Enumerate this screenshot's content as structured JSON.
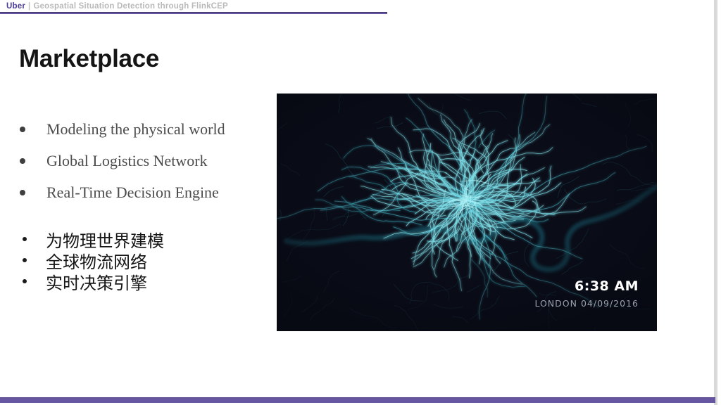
{
  "header": {
    "brand": "Uber",
    "separator": "|",
    "deck_title": "Geospatial Situation Detection through FlinkCEP"
  },
  "slide": {
    "title": "Marketplace"
  },
  "bullets_en": {
    "items": [
      "Modeling the physical world",
      "Global Logistics Network",
      "Real-Time Decision Engine"
    ]
  },
  "bullets_zh": {
    "items": [
      "为物理世界建模",
      "全球物流网络",
      "实时决策引擎"
    ]
  },
  "map": {
    "time": "6:38 AM",
    "location_date": "LONDON 04/09/2016",
    "colors": {
      "background": "#0a0d18",
      "road_bright": "#7fe0ea",
      "road_mid": "#3fb4c6",
      "road_dim": "#2a8496",
      "core": "#c8f3f6",
      "river": "#17505f"
    }
  },
  "theme": {
    "accent_purple": "#6656a2",
    "brand_purple": "#4c3c98",
    "header_gray": "#b9b9b9",
    "border_gray": "#d9d9d9"
  }
}
